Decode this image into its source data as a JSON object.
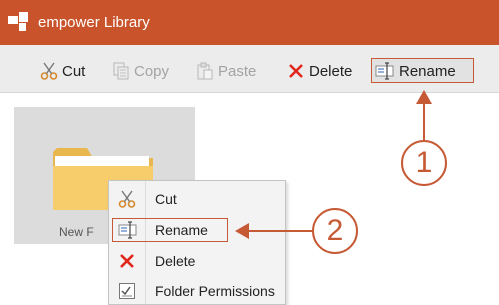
{
  "app": {
    "title": "empower Library",
    "logo_icon": "empower-logo-icon",
    "brand_color": "#c9542b"
  },
  "toolbar": {
    "cut": {
      "label": "Cut",
      "icon": "scissors-icon"
    },
    "copy": {
      "label": "Copy",
      "icon": "copy-icon",
      "disabled": true
    },
    "paste": {
      "label": "Paste",
      "icon": "paste-icon",
      "disabled": true
    },
    "delete": {
      "label": "Delete",
      "icon": "x-icon"
    },
    "rename": {
      "label": "Rename",
      "icon": "rename-icon"
    }
  },
  "folder": {
    "label": "New F",
    "icon": "folder-icon"
  },
  "context_menu": {
    "items": [
      {
        "label": "Cut",
        "icon": "scissors-icon"
      },
      {
        "label": "Rename",
        "icon": "rename-icon",
        "highlighted": true
      },
      {
        "label": "Delete",
        "icon": "x-icon"
      },
      {
        "label": "Folder Permissions",
        "icon": "checklist-icon"
      }
    ]
  },
  "callouts": [
    {
      "number": "1"
    },
    {
      "number": "2"
    }
  ],
  "accent_color": "#c65a34"
}
